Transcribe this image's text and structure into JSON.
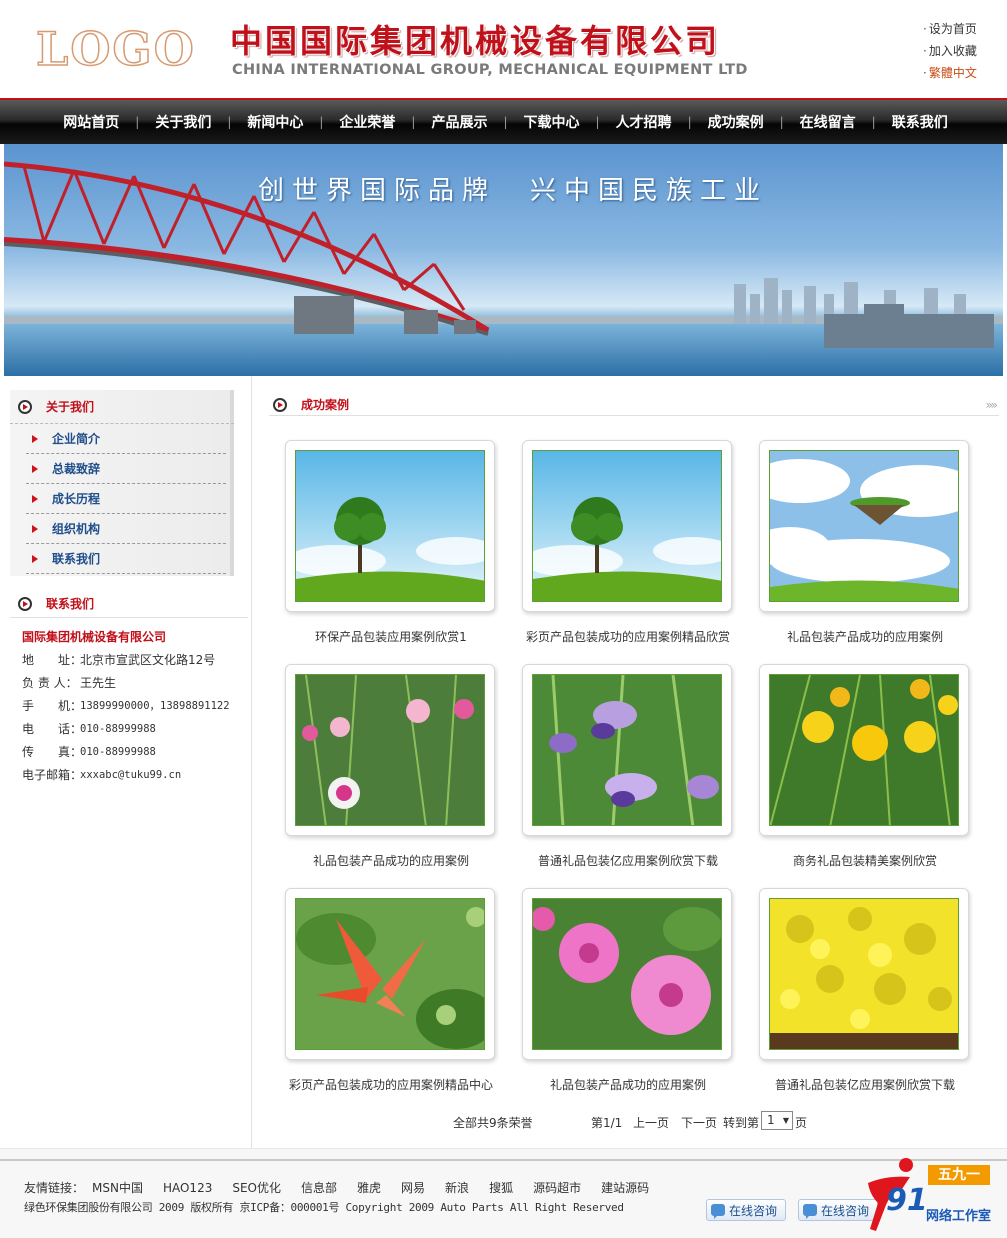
{
  "header": {
    "logo_text": "LOGO",
    "company_cn": "中国国际集团机械设备有限公司",
    "company_en": "CHINA INTERNATIONAL GROUP, MECHANICAL EQUIPMENT LTD",
    "top_links": [
      "设为首页",
      "加入收藏",
      "繁體中文"
    ]
  },
  "nav": {
    "items": [
      "网站首页",
      "关于我们",
      "新闻中心",
      "企业荣誉",
      "产品展示",
      "下载中心",
      "人才招聘",
      "成功案例",
      "在线留言",
      "联系我们"
    ]
  },
  "banner": {
    "slogan": "创世界国际品牌　兴中国民族工业"
  },
  "sidebar": {
    "about_title": "关于我们",
    "about_items": [
      "企业简介",
      "总裁致辞",
      "成长历程",
      "组织机构",
      "联系我们"
    ],
    "contact_title": "联系我们",
    "contact_company": "国际集团机械设备有限公司",
    "contact_rows": [
      {
        "label": "地　　址：",
        "value": "北京市宣武区文化路12号"
      },
      {
        "label": "负 责 人：",
        "value": "王先生"
      },
      {
        "label": "手　　机：",
        "value": "13899990000，13898891122"
      },
      {
        "label": "电　　话：",
        "value": "010-88999988"
      },
      {
        "label": "传　　真：",
        "value": "010-88999988"
      },
      {
        "label": "电子邮箱：",
        "value": "xxxabc@tuku99.cn"
      }
    ]
  },
  "main": {
    "title": "成功案例",
    "cases": [
      {
        "caption": "环保产品包装应用案例欣赏1",
        "image": "tree-meadow"
      },
      {
        "caption": "彩页产品包装成功的应用案例精品欣赏",
        "image": "tree-meadow"
      },
      {
        "caption": "礼品包装产品成功的应用案例",
        "image": "floating-island"
      },
      {
        "caption": "礼品包装产品成功的应用案例",
        "image": "pink-carnations"
      },
      {
        "caption": "普通礼品包装亿应用案例欣赏下载",
        "image": "purple-iris"
      },
      {
        "caption": "商务礼品包装精美案例欣赏",
        "image": "yellow-lilies"
      },
      {
        "caption": "彩页产品包装成功的应用案例精品中心",
        "image": "red-canna"
      },
      {
        "caption": "礼品包装产品成功的应用案例",
        "image": "pink-dianthus"
      },
      {
        "caption": "普通礼品包装亿应用案例欣赏下载",
        "image": "yellow-shrub"
      }
    ],
    "pager": {
      "total": "全部共9条荣誉",
      "position": "第1/1",
      "prev": "上一页",
      "next": "下一页",
      "jump": "转到第",
      "page_value": "1",
      "page_suffix": "页"
    }
  },
  "footer": {
    "links_label": "友情链接：",
    "links": [
      "MSN中国",
      "HAO123",
      "SEO优化",
      "信息部",
      "雅虎",
      "网易",
      "新浪",
      "搜狐",
      "源码超市",
      "建站源码"
    ],
    "copyright": "绿色环保集团股份有限公司 2009 版权所有 京ICP备：000001号 Copyright 2009 Auto Parts All Right Reserved",
    "consult_buttons": [
      "在线咨询",
      "在线咨询"
    ],
    "studio_number": "91",
    "studio_tag": "五九一",
    "studio_name": "网络工作室"
  },
  "colors": {
    "brand_red": "#c0101a",
    "nav_black": "#1a1a1a",
    "link_blue": "#1f4e8a"
  }
}
